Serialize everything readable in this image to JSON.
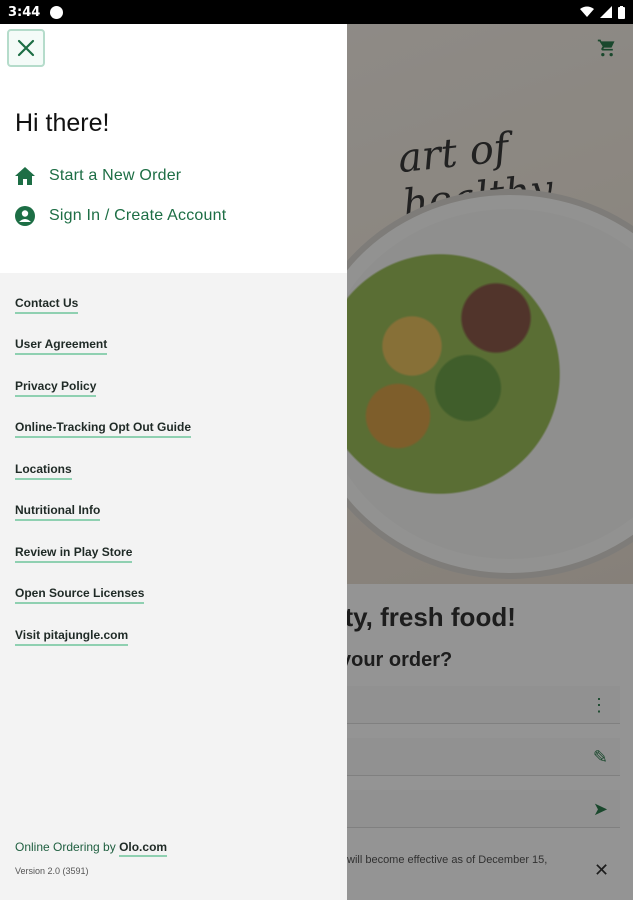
{
  "status_bar": {
    "time": "3:44"
  },
  "background": {
    "headline": "sty, fresh food!",
    "subheadline": "your order?",
    "legal_snippet": "will become effective as of December 15,",
    "cart_icon": "cart-icon"
  },
  "drawer": {
    "greeting": "Hi there!",
    "menu": [
      {
        "label": "Start a New Order",
        "icon": "home-icon"
      },
      {
        "label": "Sign In / Create Account",
        "icon": "account-icon"
      }
    ],
    "links": [
      "Contact Us",
      "User Agreement",
      "Privacy Policy",
      "Online-Tracking Opt Out Guide",
      "Locations",
      "Nutritional Info",
      "Review in Play Store",
      "Open Source Licenses",
      "Visit pitajungle.com"
    ],
    "footer": {
      "prefix": "Online Ordering by",
      "brand_link": "Olo.com",
      "version": "Version 2.0 (3591)"
    }
  },
  "colors": {
    "accent_green": "#1d6e45",
    "link_underline": "#8fd0b1"
  }
}
